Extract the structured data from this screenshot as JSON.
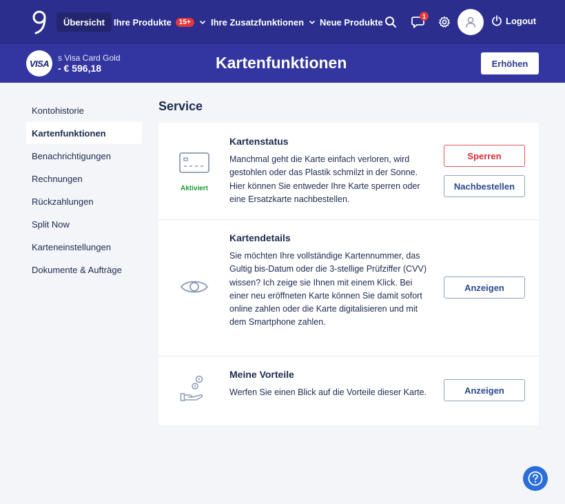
{
  "nav": {
    "items": [
      {
        "label": "Übersicht"
      },
      {
        "label": "Ihre Produkte",
        "badge": "15+"
      },
      {
        "label": "Ihre Zusatzfunktionen"
      },
      {
        "label": "Neue Produkte"
      }
    ],
    "messages_badge": "1",
    "logout_label": "Logout"
  },
  "subheader": {
    "visa_logo": "VISA",
    "card_name": "s Visa Card Gold",
    "card_balance": "- € 596,18",
    "page_title": "Kartenfunktionen",
    "raise_label": "Erhöhen"
  },
  "sidebar": {
    "items": [
      {
        "label": "Kontohistorie"
      },
      {
        "label": "Kartenfunktionen"
      },
      {
        "label": "Benachrichtigungen"
      },
      {
        "label": "Rechnungen"
      },
      {
        "label": "Rückzahlungen"
      },
      {
        "label": "Split Now"
      },
      {
        "label": "Karteneinstellungen"
      },
      {
        "label": "Dokumente & Aufträge"
      }
    ]
  },
  "main": {
    "section_title": "Service",
    "rows": [
      {
        "icon": "card-icon",
        "status": "Aktiviert",
        "title": "Kartenstatus",
        "text": "Manchmal geht die Karte einfach verloren, wird gestohlen oder das Plastik schmilzt in der Sonne. Hier können Sie entweder Ihre Karte sperren oder eine Ersatzkarte nachbestellen.",
        "buttons": [
          "Sperren",
          "Nachbestellen"
        ]
      },
      {
        "icon": "eye-icon",
        "title": "Kartendetails",
        "text": "Sie möchten Ihre vollständige Kartennummer, das Gultig bis-Datum oder die 3-stellige Prüfziffer (CVV) wissen? Ich zeige sie Ihnen mit einem Klick. Bei einer neu eröffneten Karte können Sie damit sofort online zahlen oder die Karte digitalisieren und mit dem Smartphone zahlen.",
        "buttons": [
          "Anzeigen"
        ]
      },
      {
        "icon": "coins-hand-icon",
        "title": "Meine Vorteile",
        "text": "Werfen Sie einen Blick auf die Vorteile dieser Karte.",
        "buttons": [
          "Anzeigen"
        ]
      }
    ]
  },
  "colors": {
    "nav_bg": "#2b2e8c",
    "subheader_bg": "#3336a0",
    "danger": "#d62f36",
    "success": "#1a9a35",
    "help": "#2b6ed9"
  }
}
